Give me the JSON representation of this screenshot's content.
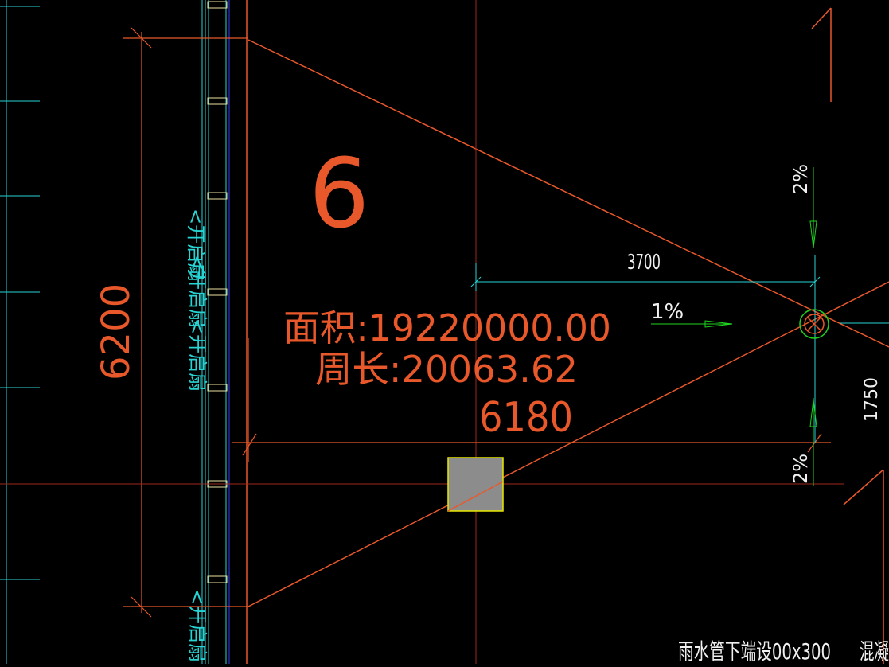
{
  "drawing": {
    "background": "#000000",
    "colors": {
      "orange": "#e8582a",
      "cyan": "#27d3d3",
      "green": "#1fd31f",
      "white": "#f0f0f0",
      "blue": "#3a3aff",
      "darkred": "#a0281e",
      "yellow": "#e8e800",
      "gray": "#8c8c8c"
    },
    "room_number": "6",
    "area_label": "面积:19220000.00",
    "perimeter_label": "周长:20063.62",
    "dims": {
      "height_6200": "6200",
      "width_6180": "6180",
      "width_3700": "3700",
      "height_1750": "1750"
    },
    "slopes": {
      "top": "2%",
      "bottom": "2%",
      "horizontal": "1%"
    },
    "window_labels": [
      "<开启扇",
      "<开启扇",
      "<开启扇",
      "<开启扇"
    ],
    "note_text": "雨水管下端设00x300",
    "note_text_2": "混凝",
    "drain_icon": "floor-drain-icon",
    "column_icon": "column-square-icon"
  }
}
